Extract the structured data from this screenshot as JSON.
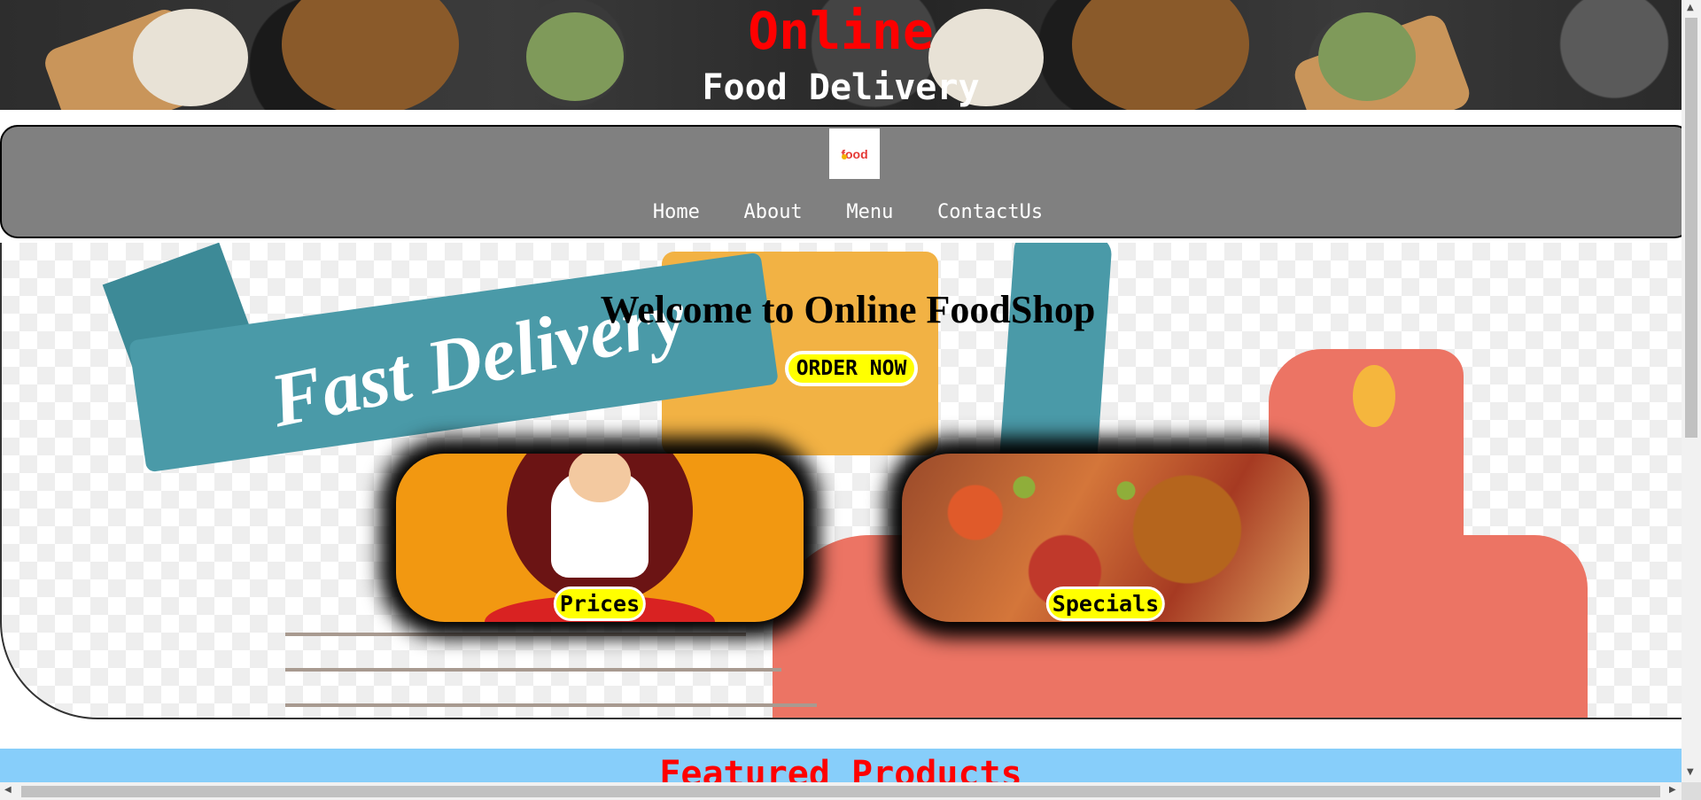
{
  "header": {
    "title_line1": "Online",
    "title_line2": "Food Delivery"
  },
  "nav": {
    "logo_text": "food",
    "links": [
      "Home",
      "About",
      "Menu",
      "ContactUs"
    ]
  },
  "hero": {
    "background_text": "Fast Delivery",
    "welcome": "Welcome to Online FoodShop",
    "order_button": "ORDER NOW",
    "cards": [
      {
        "label": "Prices"
      },
      {
        "label": "Specials"
      }
    ]
  },
  "featured": {
    "title": "Featured Products"
  },
  "colors": {
    "title_red": "#ff0000",
    "nav_gray": "#808080",
    "button_yellow": "#ffff00",
    "featured_blue": "#87cefa"
  }
}
